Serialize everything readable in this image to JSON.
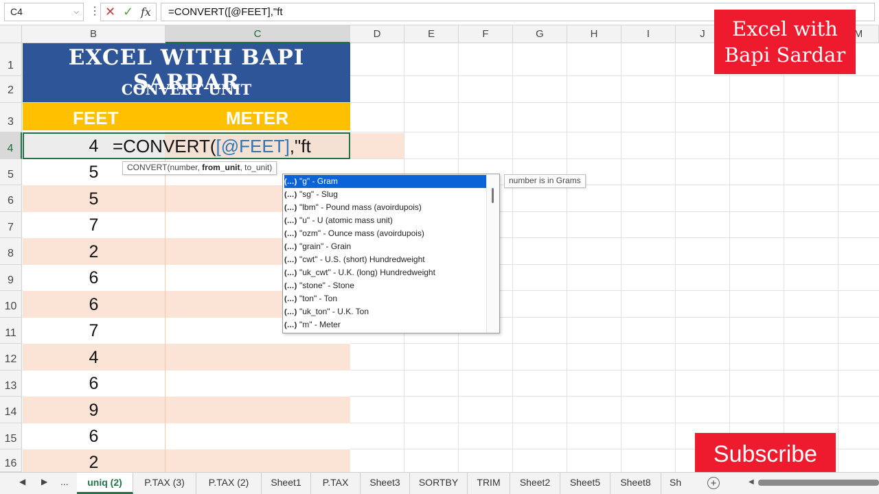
{
  "formula_bar": {
    "name_box": "C4",
    "name_box_dropdown": "⌵",
    "more": "⋮",
    "cancel": "✕",
    "enter": "✓",
    "fx": "fx",
    "formula": "=CONVERT([@FEET],\"ft"
  },
  "columns": [
    "B",
    "C",
    "D",
    "E",
    "F",
    "G",
    "H",
    "I",
    "J",
    "K",
    "L",
    "M"
  ],
  "rows": [
    "1",
    "2",
    "3",
    "4",
    "5",
    "6",
    "7",
    "8",
    "9",
    "10",
    "11",
    "12",
    "13",
    "14",
    "15",
    "16"
  ],
  "sheet": {
    "title": "EXCEL WITH BAPI SARDAR",
    "subtitle": "CONVERT UNIT",
    "col_feet": "FEET",
    "col_meter": "METER",
    "feet_values": [
      "4",
      "5",
      "5",
      "7",
      "2",
      "6",
      "6",
      "7",
      "4",
      "6",
      "9",
      "6",
      "2"
    ]
  },
  "editing": {
    "prefix": "=CONVERT(",
    "ref": "[@FEET]",
    "suffix": ",\"ft"
  },
  "tooltip": {
    "fn": "CONVERT(number, ",
    "bold_arg": "from_unit",
    "rest": ", to_unit)"
  },
  "autocomplete": {
    "icon_text": "(…)",
    "items": [
      "\"g\" - Gram",
      "\"sg\" - Slug",
      "\"lbm\" - Pound mass (avoirdupois)",
      "\"u\" - U (atomic mass unit)",
      "\"ozm\" - Ounce mass (avoirdupois)",
      "\"grain\" - Grain",
      "\"cwt\" - U.S. (short) Hundredweight",
      "\"uk_cwt\" - U.K. (long) Hundredweight",
      "\"stone\" - Stone",
      "\"ton\" - Ton",
      "\"uk_ton\" - U.K. Ton",
      "\"m\" - Meter"
    ],
    "description": "number is in Grams"
  },
  "overlay": {
    "brand_line1": "Excel with",
    "brand_line2": "Bapi Sardar",
    "subscribe": "Subscribe"
  },
  "tabs": {
    "nav_prev": "◀",
    "nav_next": "▶",
    "more": "...",
    "items": [
      "uniq (2)",
      "P.TAX (3)",
      "P.TAX (2)",
      "Sheet1",
      "P.TAX",
      "Sheet3",
      "SORTBY",
      "TRIM",
      "Sheet2",
      "Sheet5",
      "Sheet8",
      "Sh"
    ],
    "add": "+"
  },
  "colors": {
    "title_blue": "#2e5597",
    "header_gold": "#ffc000",
    "stripe_peach": "#fbe4d5",
    "excel_green": "#217346",
    "brand_red": "#ee1b2e"
  }
}
